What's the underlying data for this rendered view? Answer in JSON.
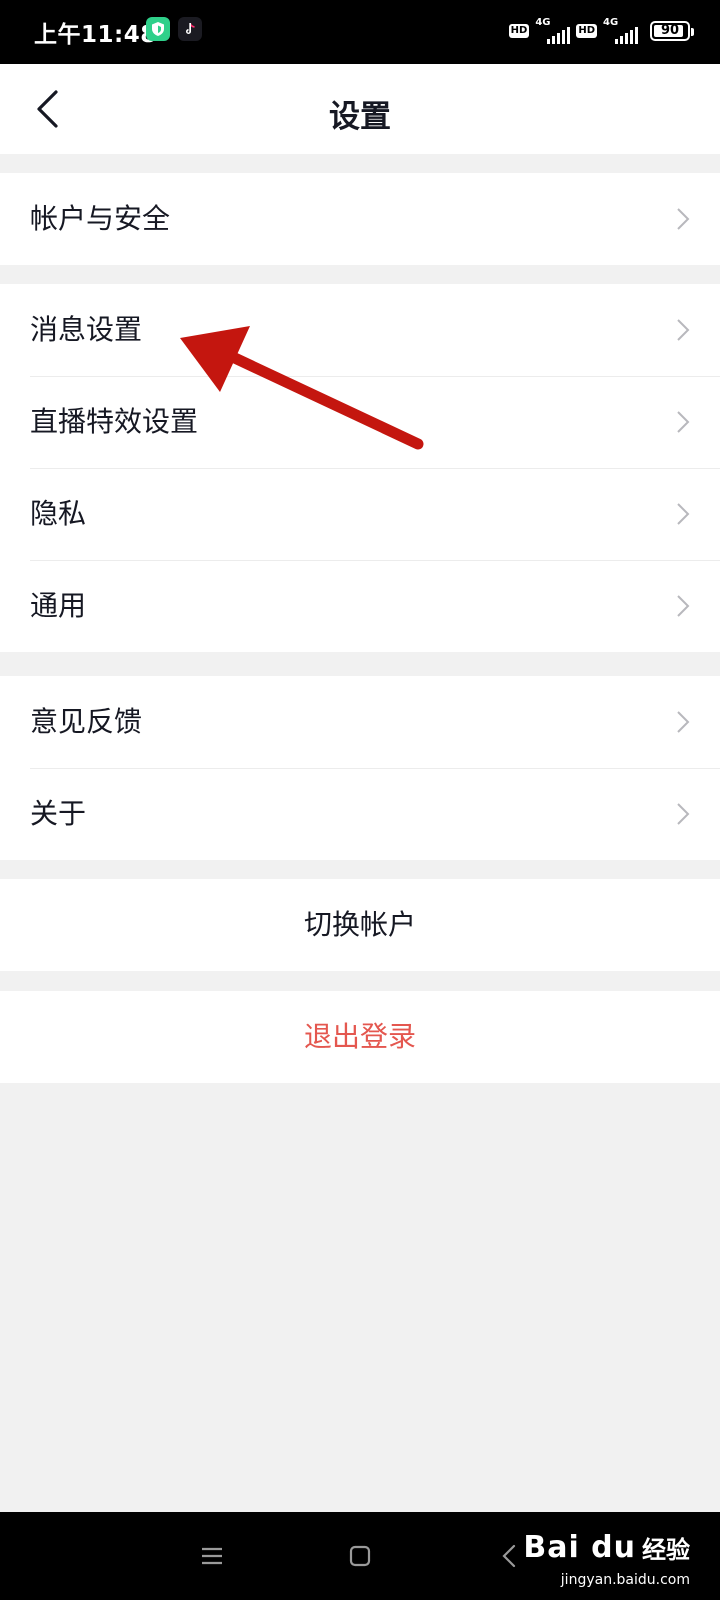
{
  "status_bar": {
    "time": "上午11:48",
    "hd_1": "HD",
    "hd_2": "HD",
    "network_1": "4G",
    "network_2": "4G",
    "battery": "90",
    "battery_level": 0.9
  },
  "header": {
    "title": "设置"
  },
  "groups": {
    "account": {
      "items": [
        {
          "label": "帐户与安全"
        }
      ]
    },
    "main": {
      "items": [
        {
          "label": "消息设置"
        },
        {
          "label": "直播特效设置"
        },
        {
          "label": "隐私"
        },
        {
          "label": "通用"
        }
      ]
    },
    "support": {
      "items": [
        {
          "label": "意见反馈"
        },
        {
          "label": "关于"
        }
      ]
    }
  },
  "actions": {
    "switch_account": "切换帐户",
    "logout": "退出登录"
  },
  "colors": {
    "logout_text": "#e4574f",
    "annotation_arrow": "#c4160f"
  },
  "watermark": {
    "brand": "Bai du",
    "sub": "经验",
    "url": "jingyan.baidu.com"
  }
}
